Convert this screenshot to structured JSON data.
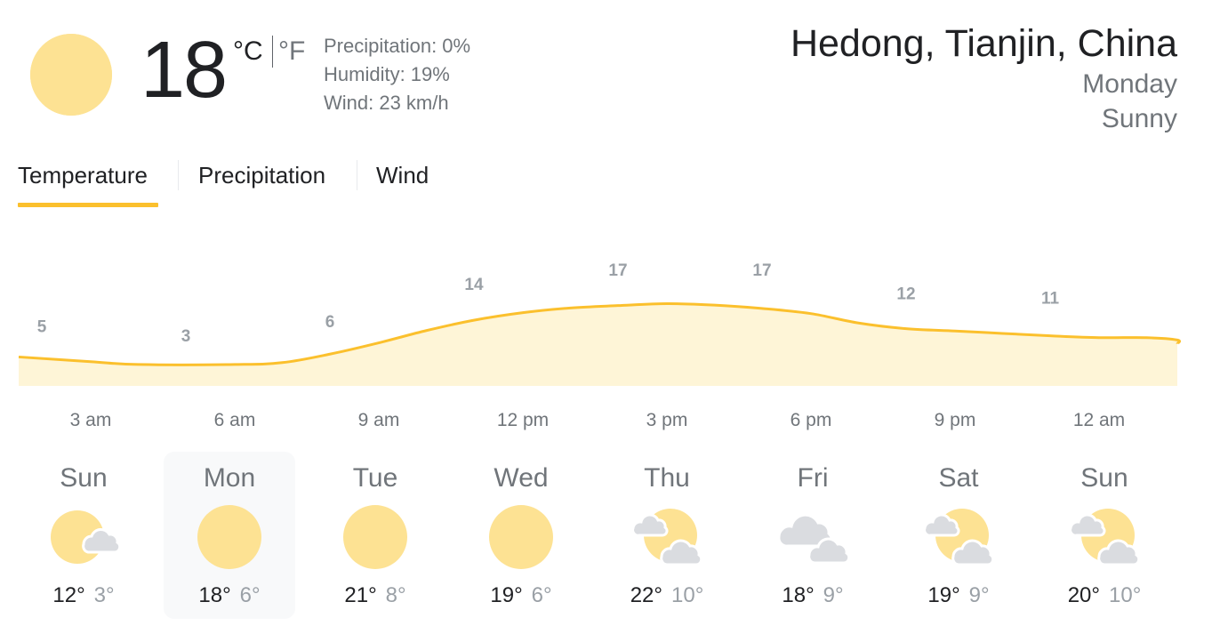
{
  "current": {
    "condition_icon": "sun-icon",
    "temperature": "18",
    "unit_c": "°C",
    "unit_f": "°F",
    "precipitation": "Precipitation: 0%",
    "humidity": "Humidity: 19%",
    "wind": "Wind: 23 km/h"
  },
  "location": {
    "name": "Hedong, Tianjin, China",
    "day": "Monday",
    "condition": "Sunny"
  },
  "tabs": [
    {
      "label": "Temperature",
      "selected": true
    },
    {
      "label": "Precipitation",
      "selected": false
    },
    {
      "label": "Wind",
      "selected": false
    }
  ],
  "colors": {
    "accent": "#fbc02d",
    "line": "#fbc02d",
    "fill": "#fef5d7",
    "sun": "#fde293",
    "cloud": "#dadce0"
  },
  "chart_data": {
    "type": "area",
    "x": [
      "3 am",
      "6 am",
      "9 am",
      "12 pm",
      "3 pm",
      "6 pm",
      "9 pm",
      "12 am"
    ],
    "values": [
      5,
      3,
      6,
      14,
      17,
      17,
      12,
      11
    ],
    "labels": [
      "5",
      "3",
      "6",
      "14",
      "17",
      "17",
      "12",
      "11"
    ],
    "curve": [
      {
        "x": -0.5,
        "y": 5.2
      },
      {
        "x": 0.0,
        "y": 4.2
      },
      {
        "x": 0.33,
        "y": 3.6
      },
      {
        "x": 1.0,
        "y": 3.6
      },
      {
        "x": 1.33,
        "y": 4.0
      },
      {
        "x": 1.66,
        "y": 5.8
      },
      {
        "x": 2.0,
        "y": 8.2
      },
      {
        "x": 2.33,
        "y": 10.8
      },
      {
        "x": 2.66,
        "y": 13.0
      },
      {
        "x": 3.0,
        "y": 14.6
      },
      {
        "x": 3.33,
        "y": 15.6
      },
      {
        "x": 3.66,
        "y": 16.1
      },
      {
        "x": 4.0,
        "y": 16.5
      },
      {
        "x": 4.33,
        "y": 16.2
      },
      {
        "x": 4.66,
        "y": 15.5
      },
      {
        "x": 5.0,
        "y": 14.4
      },
      {
        "x": 5.33,
        "y": 12.4
      },
      {
        "x": 5.66,
        "y": 11.2
      },
      {
        "x": 6.0,
        "y": 10.7
      },
      {
        "x": 6.33,
        "y": 10.2
      },
      {
        "x": 6.66,
        "y": 9.7
      },
      {
        "x": 7.0,
        "y": 9.3
      },
      {
        "x": 7.33,
        "y": 9.3
      },
      {
        "x": 7.66,
        "y": 8.8
      },
      {
        "x": 8.0,
        "y": 8.0
      }
    ]
  },
  "forecast": [
    {
      "day": "Sun",
      "icon": "partly-cloudy-icon",
      "high": "12°",
      "low": "3°",
      "selected": false
    },
    {
      "day": "Mon",
      "icon": "sun-icon",
      "high": "18°",
      "low": "6°",
      "selected": true
    },
    {
      "day": "Tue",
      "icon": "sun-icon",
      "high": "21°",
      "low": "8°",
      "selected": false
    },
    {
      "day": "Wed",
      "icon": "sun-icon",
      "high": "19°",
      "low": "6°",
      "selected": false
    },
    {
      "day": "Thu",
      "icon": "mostly-cloudy-icon",
      "high": "22°",
      "low": "10°",
      "selected": false
    },
    {
      "day": "Fri",
      "icon": "cloudy-icon",
      "high": "18°",
      "low": "9°",
      "selected": false
    },
    {
      "day": "Sat",
      "icon": "mostly-cloudy-icon",
      "high": "19°",
      "low": "9°",
      "selected": false
    },
    {
      "day": "Sun",
      "icon": "mostly-cloudy-icon",
      "high": "20°",
      "low": "10°",
      "selected": false
    }
  ]
}
